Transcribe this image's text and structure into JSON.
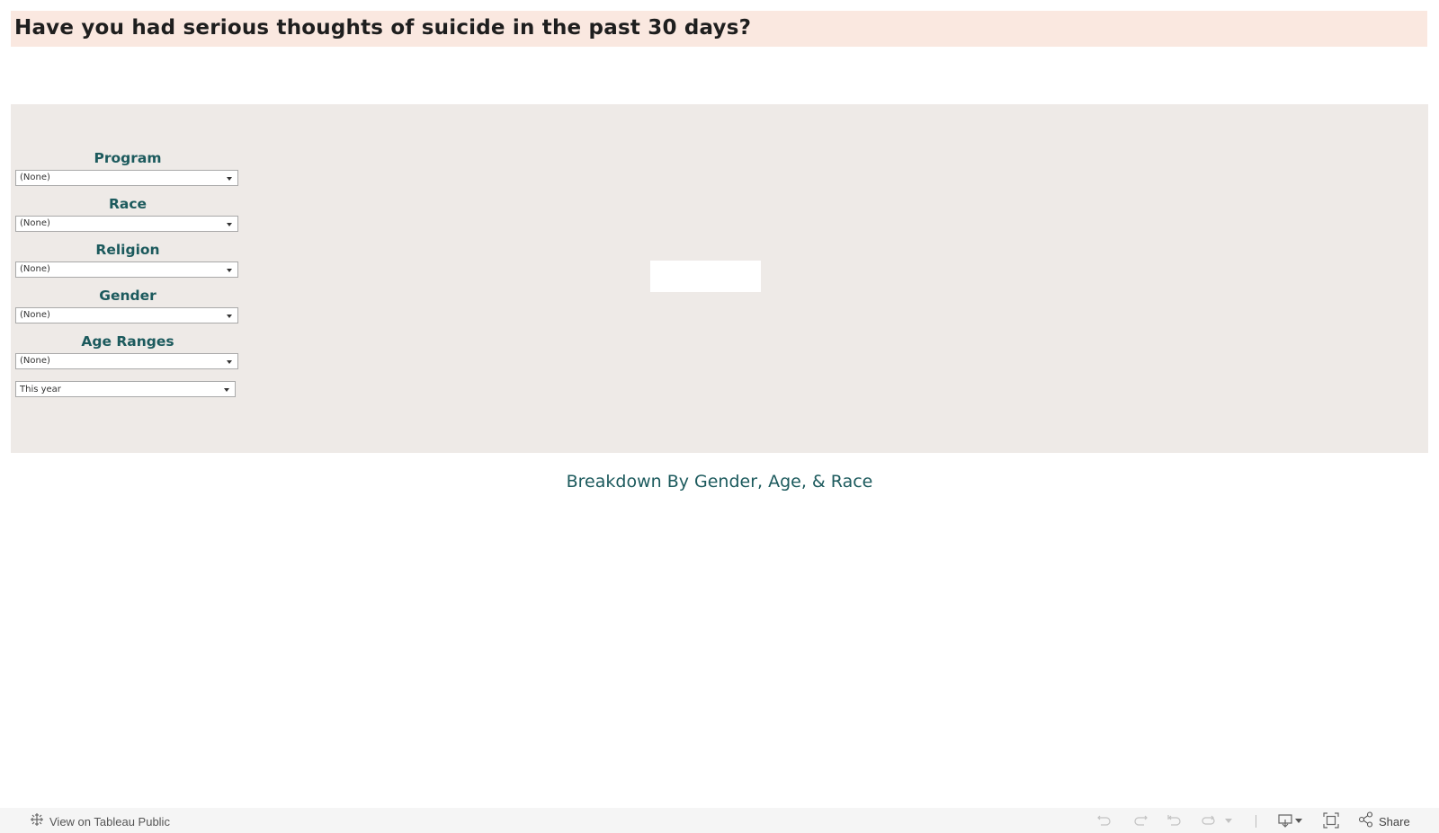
{
  "header": {
    "title": "Have you had serious thoughts of suicide in the past 30 days?"
  },
  "filters": [
    {
      "label": "Program",
      "value": "(None)"
    },
    {
      "label": "Race",
      "value": "(None)"
    },
    {
      "label": "Religion",
      "value": "(None)"
    },
    {
      "label": "Gender",
      "value": "(None)"
    },
    {
      "label": "Age Ranges",
      "value": "(None)"
    }
  ],
  "date_filter": {
    "value": "This year"
  },
  "section": {
    "title": "Breakdown By Gender, Age, & Race"
  },
  "footer": {
    "view_on_label": "View on Tableau Public",
    "share_label": "Share",
    "icons": [
      "undo-icon",
      "redo-icon",
      "revert-icon",
      "refresh-icon",
      "pause-dropdown-icon",
      "download-icon",
      "fullscreen-icon",
      "share-icon"
    ]
  },
  "colors": {
    "title_band": "#fae8e0",
    "panel_bg": "#eeeae7",
    "accent_teal": "#1c5a5d",
    "title_text": "#1e1e1e"
  }
}
